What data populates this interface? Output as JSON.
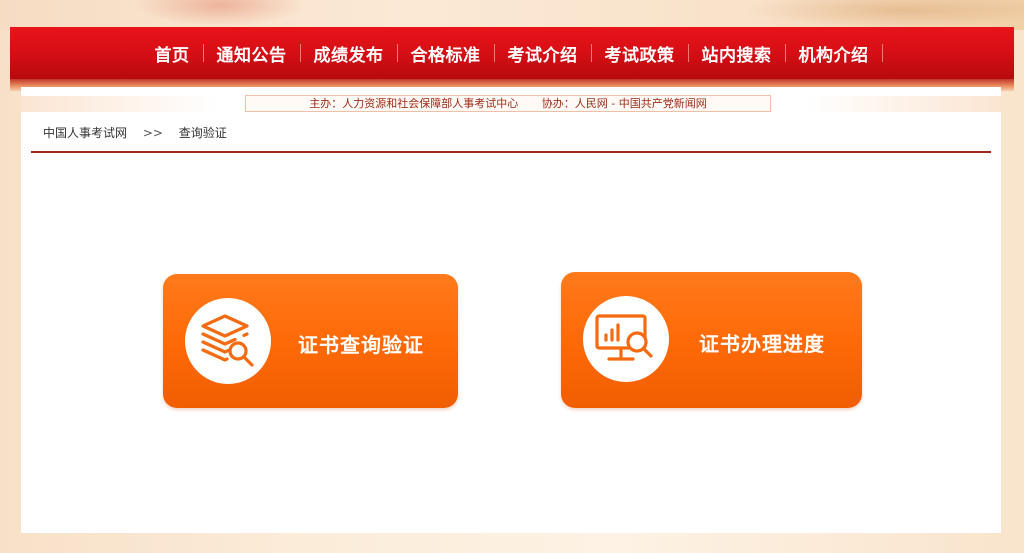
{
  "nav": {
    "items": [
      {
        "label": "首页"
      },
      {
        "label": "通知公告"
      },
      {
        "label": "成绩发布"
      },
      {
        "label": "合格标准"
      },
      {
        "label": "考试介绍"
      },
      {
        "label": "考试政策"
      },
      {
        "label": "站内搜索"
      },
      {
        "label": "机构介绍"
      }
    ]
  },
  "sponsor": {
    "host": "主办：人力资源和社会保障部人事考试中心",
    "co": "协办：人民网 - 中国共产党新闻网"
  },
  "breadcrumb": {
    "home": "中国人事考试网",
    "separator": ">>",
    "current": "查询验证"
  },
  "cards": [
    {
      "label": "证书查询验证",
      "icon": "layers-search-icon"
    },
    {
      "label": "证书办理进度",
      "icon": "monitor-chart-search-icon"
    }
  ],
  "colors": {
    "nav_red": "#d80f15",
    "card_orange": "#ff6a08",
    "rule_red": "#a9221c"
  }
}
